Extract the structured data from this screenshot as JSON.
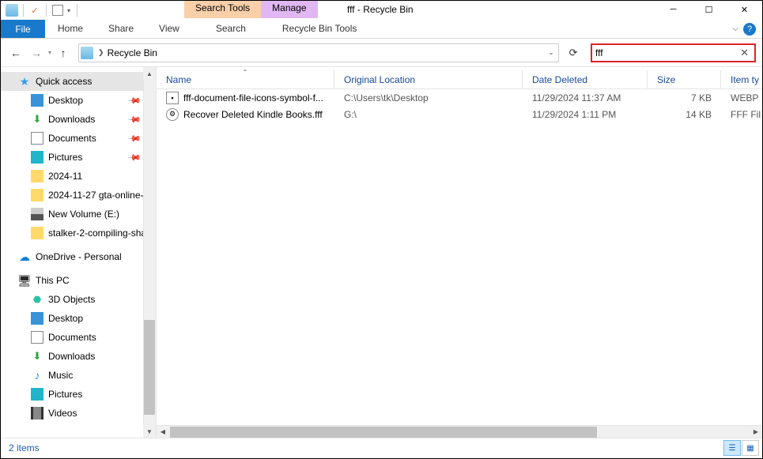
{
  "window": {
    "title": "fff - Recycle Bin"
  },
  "context_tabs": {
    "search": "Search Tools",
    "manage": "Manage"
  },
  "ribbon": {
    "file": "File",
    "home": "Home",
    "share": "Share",
    "view": "View",
    "search": "Search",
    "recycle": "Recycle Bin Tools"
  },
  "address": {
    "location": "Recycle Bin"
  },
  "search": {
    "value": "fff"
  },
  "nav": {
    "quick_access": "Quick access",
    "desktop": "Desktop",
    "downloads": "Downloads",
    "documents": "Documents",
    "pictures": "Pictures",
    "f_202411": "2024-11",
    "f_gta": "2024-11-27 gta-online-fi",
    "new_volume": "New Volume (E:)",
    "f_stalker": "stalker-2-compiling-sha",
    "onedrive": "OneDrive - Personal",
    "this_pc": "This PC",
    "objects3d": "3D Objects",
    "pc_desktop": "Desktop",
    "pc_documents": "Documents",
    "pc_downloads": "Downloads",
    "pc_music": "Music",
    "pc_pictures": "Pictures",
    "pc_videos": "Videos"
  },
  "columns": {
    "name": "Name",
    "location": "Original Location",
    "date": "Date Deleted",
    "size": "Size",
    "type": "Item ty"
  },
  "files": [
    {
      "name": "fff-document-file-icons-symbol-f...",
      "location": "C:\\Users\\tk\\Desktop",
      "date": "11/29/2024 11:37 AM",
      "size": "7 KB",
      "type": "WEBP"
    },
    {
      "name": "Recover Deleted Kindle Books.fff",
      "location": "G:\\",
      "date": "11/29/2024 1:11 PM",
      "size": "14 KB",
      "type": "FFF Fil"
    }
  ],
  "status": {
    "count": "2 items"
  }
}
